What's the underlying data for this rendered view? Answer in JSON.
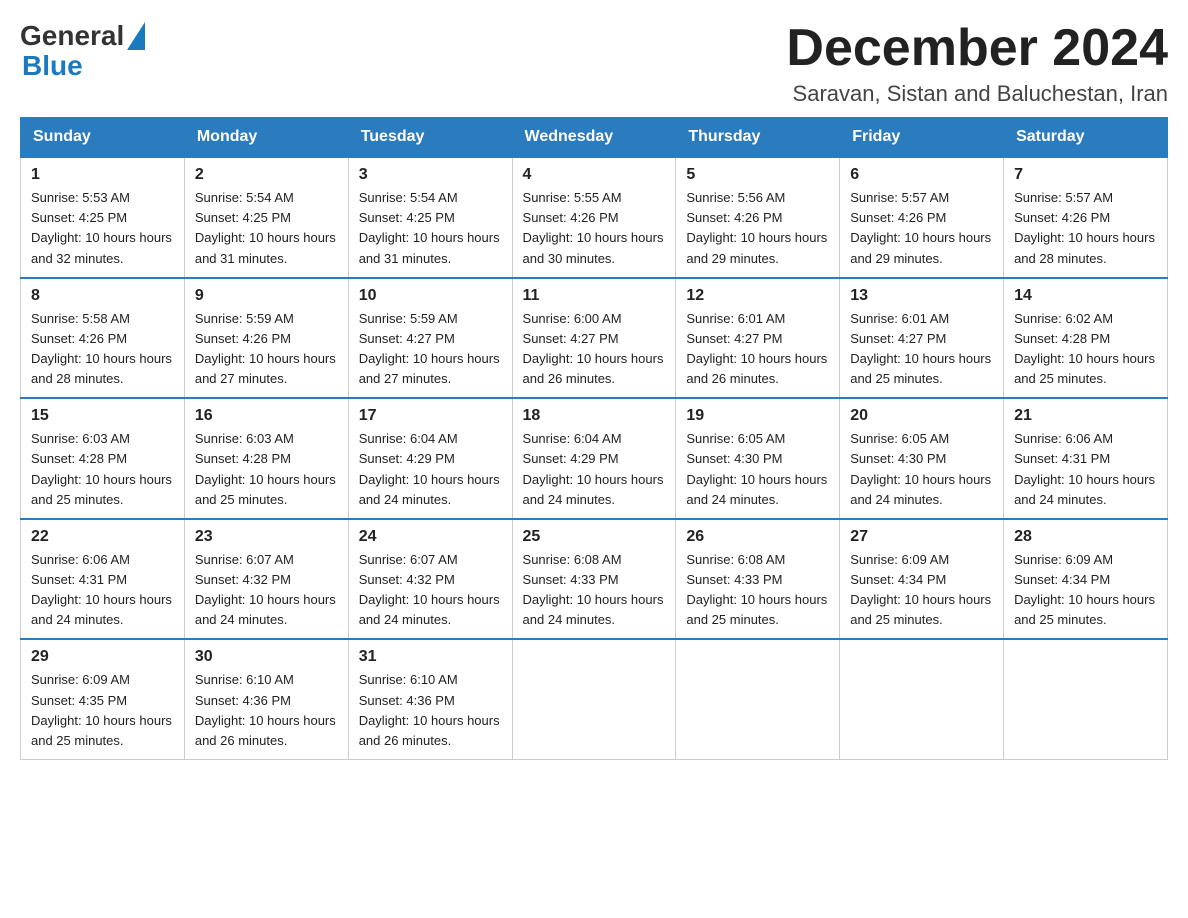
{
  "header": {
    "logo_general": "General",
    "logo_blue": "Blue",
    "month_title": "December 2024",
    "location": "Saravan, Sistan and Baluchestan, Iran"
  },
  "days_of_week": [
    "Sunday",
    "Monday",
    "Tuesday",
    "Wednesday",
    "Thursday",
    "Friday",
    "Saturday"
  ],
  "weeks": [
    [
      {
        "day": "1",
        "sunrise": "5:53 AM",
        "sunset": "4:25 PM",
        "daylight": "10 hours and 32 minutes."
      },
      {
        "day": "2",
        "sunrise": "5:54 AM",
        "sunset": "4:25 PM",
        "daylight": "10 hours and 31 minutes."
      },
      {
        "day": "3",
        "sunrise": "5:54 AM",
        "sunset": "4:25 PM",
        "daylight": "10 hours and 31 minutes."
      },
      {
        "day": "4",
        "sunrise": "5:55 AM",
        "sunset": "4:26 PM",
        "daylight": "10 hours and 30 minutes."
      },
      {
        "day": "5",
        "sunrise": "5:56 AM",
        "sunset": "4:26 PM",
        "daylight": "10 hours and 29 minutes."
      },
      {
        "day": "6",
        "sunrise": "5:57 AM",
        "sunset": "4:26 PM",
        "daylight": "10 hours and 29 minutes."
      },
      {
        "day": "7",
        "sunrise": "5:57 AM",
        "sunset": "4:26 PM",
        "daylight": "10 hours and 28 minutes."
      }
    ],
    [
      {
        "day": "8",
        "sunrise": "5:58 AM",
        "sunset": "4:26 PM",
        "daylight": "10 hours and 28 minutes."
      },
      {
        "day": "9",
        "sunrise": "5:59 AM",
        "sunset": "4:26 PM",
        "daylight": "10 hours and 27 minutes."
      },
      {
        "day": "10",
        "sunrise": "5:59 AM",
        "sunset": "4:27 PM",
        "daylight": "10 hours and 27 minutes."
      },
      {
        "day": "11",
        "sunrise": "6:00 AM",
        "sunset": "4:27 PM",
        "daylight": "10 hours and 26 minutes."
      },
      {
        "day": "12",
        "sunrise": "6:01 AM",
        "sunset": "4:27 PM",
        "daylight": "10 hours and 26 minutes."
      },
      {
        "day": "13",
        "sunrise": "6:01 AM",
        "sunset": "4:27 PM",
        "daylight": "10 hours and 25 minutes."
      },
      {
        "day": "14",
        "sunrise": "6:02 AM",
        "sunset": "4:28 PM",
        "daylight": "10 hours and 25 minutes."
      }
    ],
    [
      {
        "day": "15",
        "sunrise": "6:03 AM",
        "sunset": "4:28 PM",
        "daylight": "10 hours and 25 minutes."
      },
      {
        "day": "16",
        "sunrise": "6:03 AM",
        "sunset": "4:28 PM",
        "daylight": "10 hours and 25 minutes."
      },
      {
        "day": "17",
        "sunrise": "6:04 AM",
        "sunset": "4:29 PM",
        "daylight": "10 hours and 24 minutes."
      },
      {
        "day": "18",
        "sunrise": "6:04 AM",
        "sunset": "4:29 PM",
        "daylight": "10 hours and 24 minutes."
      },
      {
        "day": "19",
        "sunrise": "6:05 AM",
        "sunset": "4:30 PM",
        "daylight": "10 hours and 24 minutes."
      },
      {
        "day": "20",
        "sunrise": "6:05 AM",
        "sunset": "4:30 PM",
        "daylight": "10 hours and 24 minutes."
      },
      {
        "day": "21",
        "sunrise": "6:06 AM",
        "sunset": "4:31 PM",
        "daylight": "10 hours and 24 minutes."
      }
    ],
    [
      {
        "day": "22",
        "sunrise": "6:06 AM",
        "sunset": "4:31 PM",
        "daylight": "10 hours and 24 minutes."
      },
      {
        "day": "23",
        "sunrise": "6:07 AM",
        "sunset": "4:32 PM",
        "daylight": "10 hours and 24 minutes."
      },
      {
        "day": "24",
        "sunrise": "6:07 AM",
        "sunset": "4:32 PM",
        "daylight": "10 hours and 24 minutes."
      },
      {
        "day": "25",
        "sunrise": "6:08 AM",
        "sunset": "4:33 PM",
        "daylight": "10 hours and 24 minutes."
      },
      {
        "day": "26",
        "sunrise": "6:08 AM",
        "sunset": "4:33 PM",
        "daylight": "10 hours and 25 minutes."
      },
      {
        "day": "27",
        "sunrise": "6:09 AM",
        "sunset": "4:34 PM",
        "daylight": "10 hours and 25 minutes."
      },
      {
        "day": "28",
        "sunrise": "6:09 AM",
        "sunset": "4:34 PM",
        "daylight": "10 hours and 25 minutes."
      }
    ],
    [
      {
        "day": "29",
        "sunrise": "6:09 AM",
        "sunset": "4:35 PM",
        "daylight": "10 hours and 25 minutes."
      },
      {
        "day": "30",
        "sunrise": "6:10 AM",
        "sunset": "4:36 PM",
        "daylight": "10 hours and 26 minutes."
      },
      {
        "day": "31",
        "sunrise": "6:10 AM",
        "sunset": "4:36 PM",
        "daylight": "10 hours and 26 minutes."
      },
      null,
      null,
      null,
      null
    ]
  ],
  "labels": {
    "sunrise": "Sunrise:",
    "sunset": "Sunset:",
    "daylight": "Daylight:"
  }
}
